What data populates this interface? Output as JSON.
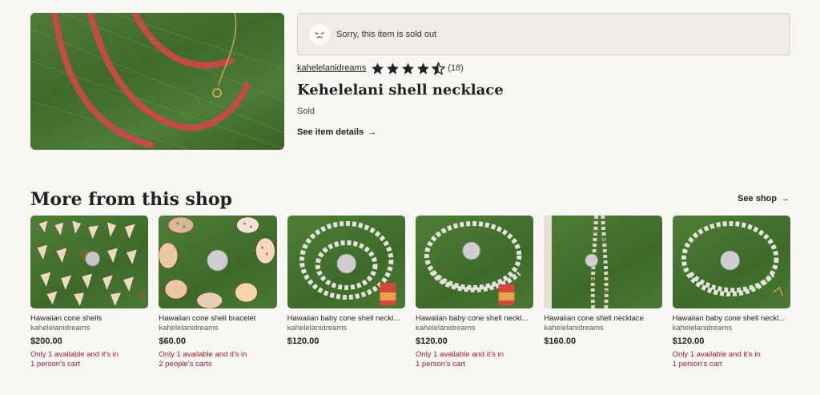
{
  "listing": {
    "sold_out_message": "Sorry, this item is sold out",
    "shop_name": "kahelelanidreams",
    "rating_stars": 4.5,
    "review_count": "(18)",
    "title": "Kehelelani shell necklace",
    "status": "Sold",
    "see_details_label": "See item details",
    "arrow": "→"
  },
  "more": {
    "heading": "More from this shop",
    "see_shop_label": "See shop",
    "arrow": "→",
    "items": [
      {
        "title": "Hawaiian cone shells",
        "shop": "kahelelanidreams",
        "price": "$200.00",
        "avail1": "Only 1 available and it's in",
        "avail2": "1 person's cart"
      },
      {
        "title": "Hawaiian cone shell bracelet",
        "shop": "kahelelanidreams",
        "price": "$60.00",
        "avail1": "Only 1 available and it's in",
        "avail2": "2 people's carts"
      },
      {
        "title": "Hawaiian baby cone shell neckl...",
        "shop": "kahelelanidreams",
        "price": "$120.00",
        "avail1": "",
        "avail2": ""
      },
      {
        "title": "Hawaiian baby cone shell neckl...",
        "shop": "kahelelanidreams",
        "price": "$120.00",
        "avail1": "Only 1 available and it's in",
        "avail2": "1 person's cart"
      },
      {
        "title": "Hawaiian cone shell necklace",
        "shop": "kahelelanidreams",
        "price": "$160.00",
        "avail1": "",
        "avail2": ""
      },
      {
        "title": "Hawaiian baby cone shell neckl...",
        "shop": "kahelelanidreams",
        "price": "$120.00",
        "avail1": "Only 1 available and it's in",
        "avail2": "1 person's cart"
      }
    ]
  },
  "colors": {
    "background": "#f8f7f4",
    "availability": "#a61a2e",
    "banner": "#efebe6"
  },
  "icons": {
    "sad_face": "sad-face-icon",
    "star": "star-icon",
    "arrow": "arrow-right-icon"
  }
}
